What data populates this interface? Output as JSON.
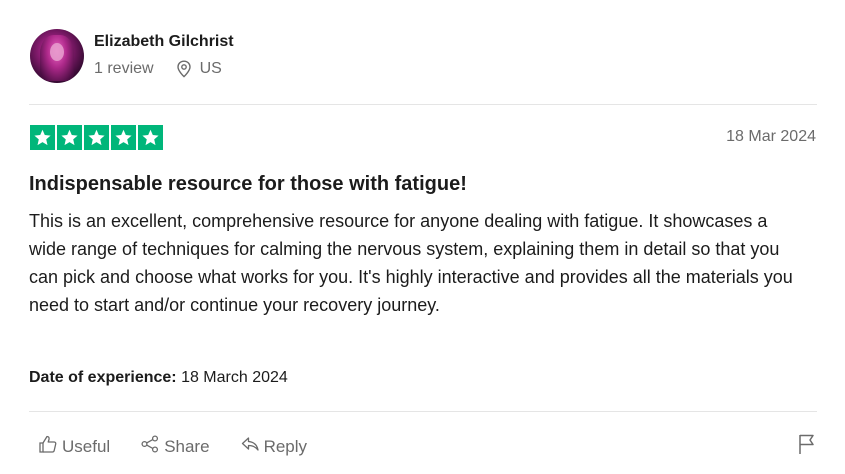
{
  "reviewer": {
    "name": "Elizabeth Gilchrist",
    "review_count": "1 review",
    "country": "US",
    "location_icon": "location-pin-icon"
  },
  "review": {
    "rating": 5,
    "rating_max": 5,
    "star_color": "#00b67a",
    "date": "18 Mar 2024",
    "title": "Indispensable resource for those with fatigue!",
    "body": "This is an excellent, comprehensive resource for anyone dealing with fatigue. It showcases a wide range of techniques for calming the nervous system, explaining them in detail so that you can pick and choose what works for you. It's highly interactive and provides all the materials you need to start and/or continue your recovery journey.",
    "experience_label": "Date of experience:",
    "experience_date": "18 March 2024"
  },
  "actions": {
    "useful_label": "Useful",
    "share_label": "Share",
    "reply_label": "Reply",
    "useful_icon": "thumbs-up-icon",
    "share_icon": "share-icon",
    "reply_icon": "reply-icon",
    "report_icon": "flag-icon"
  }
}
